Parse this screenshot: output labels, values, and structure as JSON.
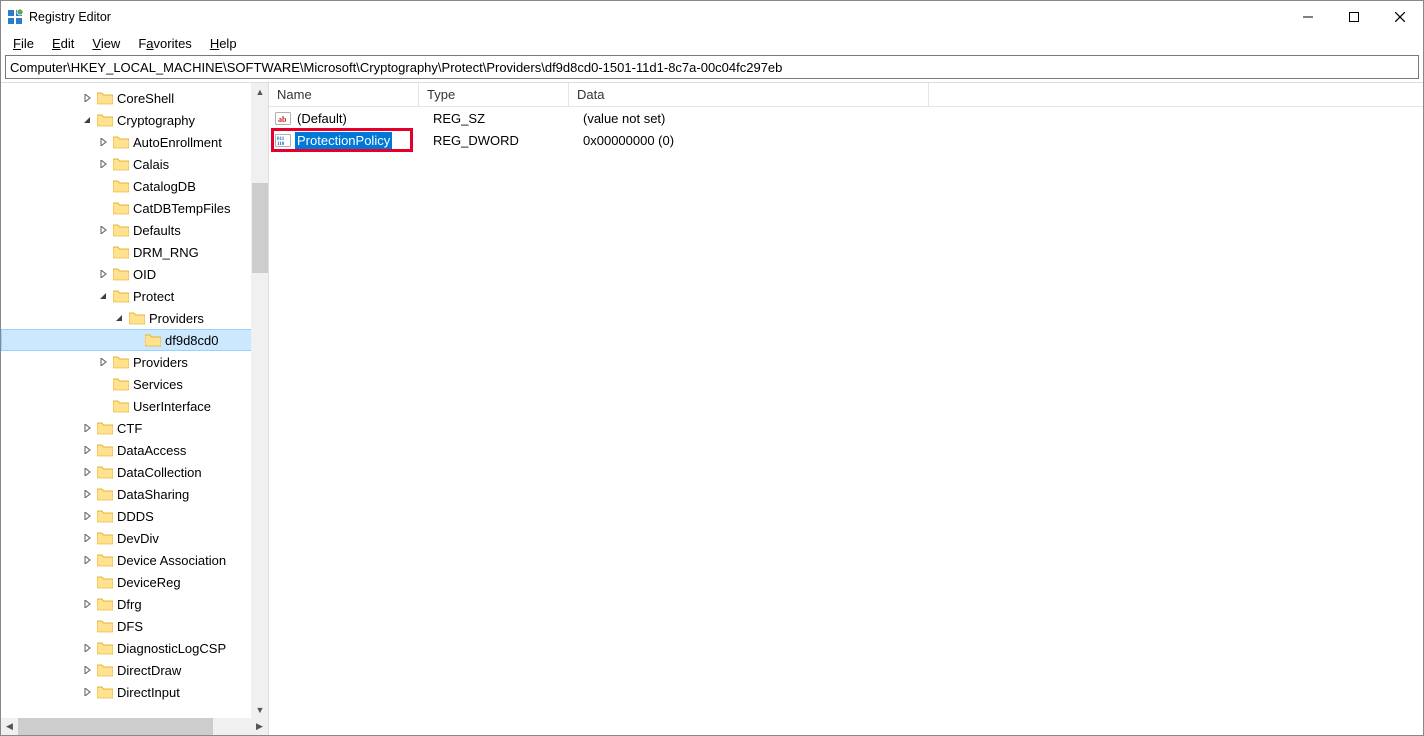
{
  "window": {
    "title": "Registry Editor"
  },
  "menu": {
    "file": "File",
    "edit": "Edit",
    "view": "View",
    "favorites": "Favorites",
    "help": "Help"
  },
  "address": "Computer\\HKEY_LOCAL_MACHINE\\SOFTWARE\\Microsoft\\Cryptography\\Protect\\Providers\\df9d8cd0-1501-11d1-8c7a-00c04fc297eb",
  "tree": {
    "nodes": [
      {
        "indent": 5,
        "toggle": "collapsed",
        "label": "CoreShell"
      },
      {
        "indent": 5,
        "toggle": "expanded",
        "label": "Cryptography"
      },
      {
        "indent": 6,
        "toggle": "collapsed",
        "label": "AutoEnrollment"
      },
      {
        "indent": 6,
        "toggle": "collapsed",
        "label": "Calais"
      },
      {
        "indent": 6,
        "toggle": "none",
        "label": "CatalogDB"
      },
      {
        "indent": 6,
        "toggle": "none",
        "label": "CatDBTempFiles"
      },
      {
        "indent": 6,
        "toggle": "collapsed",
        "label": "Defaults"
      },
      {
        "indent": 6,
        "toggle": "none",
        "label": "DRM_RNG"
      },
      {
        "indent": 6,
        "toggle": "collapsed",
        "label": "OID"
      },
      {
        "indent": 6,
        "toggle": "expanded",
        "label": "Protect"
      },
      {
        "indent": 7,
        "toggle": "expanded",
        "label": "Providers"
      },
      {
        "indent": 8,
        "toggle": "none",
        "label": "df9d8cd0",
        "selected": true
      },
      {
        "indent": 6,
        "toggle": "collapsed",
        "label": "Providers"
      },
      {
        "indent": 6,
        "toggle": "none",
        "label": "Services"
      },
      {
        "indent": 6,
        "toggle": "none",
        "label": "UserInterface"
      },
      {
        "indent": 5,
        "toggle": "collapsed",
        "label": "CTF"
      },
      {
        "indent": 5,
        "toggle": "collapsed",
        "label": "DataAccess"
      },
      {
        "indent": 5,
        "toggle": "collapsed",
        "label": "DataCollection"
      },
      {
        "indent": 5,
        "toggle": "collapsed",
        "label": "DataSharing"
      },
      {
        "indent": 5,
        "toggle": "collapsed",
        "label": "DDDS"
      },
      {
        "indent": 5,
        "toggle": "collapsed",
        "label": "DevDiv"
      },
      {
        "indent": 5,
        "toggle": "collapsed",
        "label": "Device Association"
      },
      {
        "indent": 5,
        "toggle": "none",
        "label": "DeviceReg"
      },
      {
        "indent": 5,
        "toggle": "collapsed",
        "label": "Dfrg"
      },
      {
        "indent": 5,
        "toggle": "none",
        "label": "DFS"
      },
      {
        "indent": 5,
        "toggle": "collapsed",
        "label": "DiagnosticLogCSP"
      },
      {
        "indent": 5,
        "toggle": "collapsed",
        "label": "DirectDraw"
      },
      {
        "indent": 5,
        "toggle": "collapsed",
        "label": "DirectInput"
      }
    ]
  },
  "list": {
    "columns": {
      "name": "Name",
      "type": "Type",
      "data": "Data"
    },
    "col_widths": {
      "name": 150,
      "type": 150,
      "data": 360
    },
    "rows": [
      {
        "icon": "sz",
        "name": "(Default)",
        "type": "REG_SZ",
        "data": "(value not set)",
        "selected": false
      },
      {
        "icon": "dword",
        "name": "ProtectionPolicy",
        "type": "REG_DWORD",
        "data": "0x00000000 (0)",
        "selected": true,
        "highlight": true
      }
    ]
  }
}
